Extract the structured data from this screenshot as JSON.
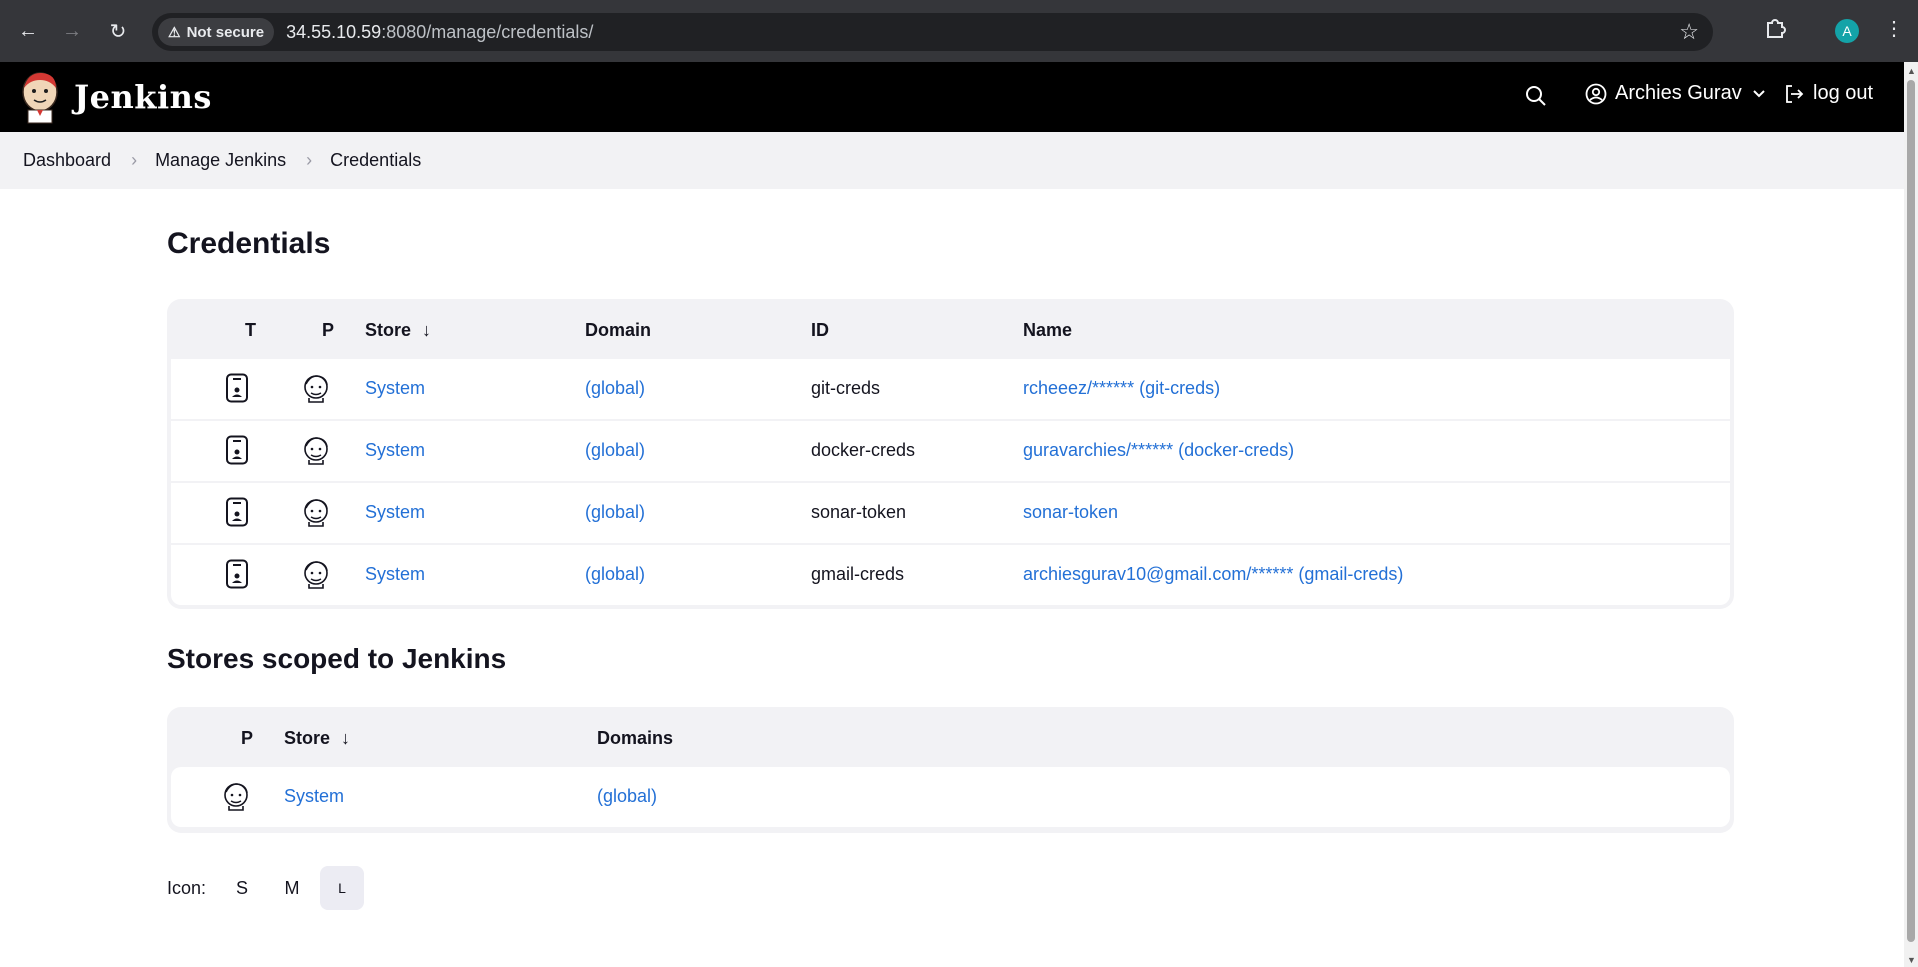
{
  "browser": {
    "security_chip": "Not secure",
    "url_host": "34.55.10.59",
    "url_path": ":8080/manage/credentials/",
    "profile_initial": "A"
  },
  "header": {
    "brand": "Jenkins",
    "user_name": "Archies Gurav",
    "logout_label": "log out"
  },
  "breadcrumb": [
    "Dashboard",
    "Manage Jenkins",
    "Credentials"
  ],
  "page_title": "Credentials",
  "credentials_table": {
    "headers": {
      "t": "T",
      "p": "P",
      "store": "Store",
      "sort_arrow": "↓",
      "domain": "Domain",
      "id": "ID",
      "name": "Name"
    },
    "rows": [
      {
        "store": "System",
        "domain": "(global)",
        "id": "git-creds",
        "name": "rcheeez/****** (git-creds)"
      },
      {
        "store": "System",
        "domain": "(global)",
        "id": "docker-creds",
        "name": "guravarchies/****** (docker-creds)"
      },
      {
        "store": "System",
        "domain": "(global)",
        "id": "sonar-token",
        "name": "sonar-token"
      },
      {
        "store": "System",
        "domain": "(global)",
        "id": "gmail-creds",
        "name": "archiesgurav10@gmail.com/****** (gmail-creds)"
      }
    ]
  },
  "stores_title": "Stores scoped to Jenkins",
  "stores_table": {
    "headers": {
      "p": "P",
      "store": "Store",
      "sort_arrow": "↓",
      "domains": "Domains"
    },
    "rows": [
      {
        "store": "System",
        "domains": "(global)"
      }
    ]
  },
  "icon_size": {
    "label": "Icon:",
    "options": [
      "S",
      "M",
      "L"
    ],
    "selected": "L"
  },
  "colors": {
    "link": "#2370d6",
    "header_bg": "#000000",
    "browser_bg": "#35363a"
  }
}
